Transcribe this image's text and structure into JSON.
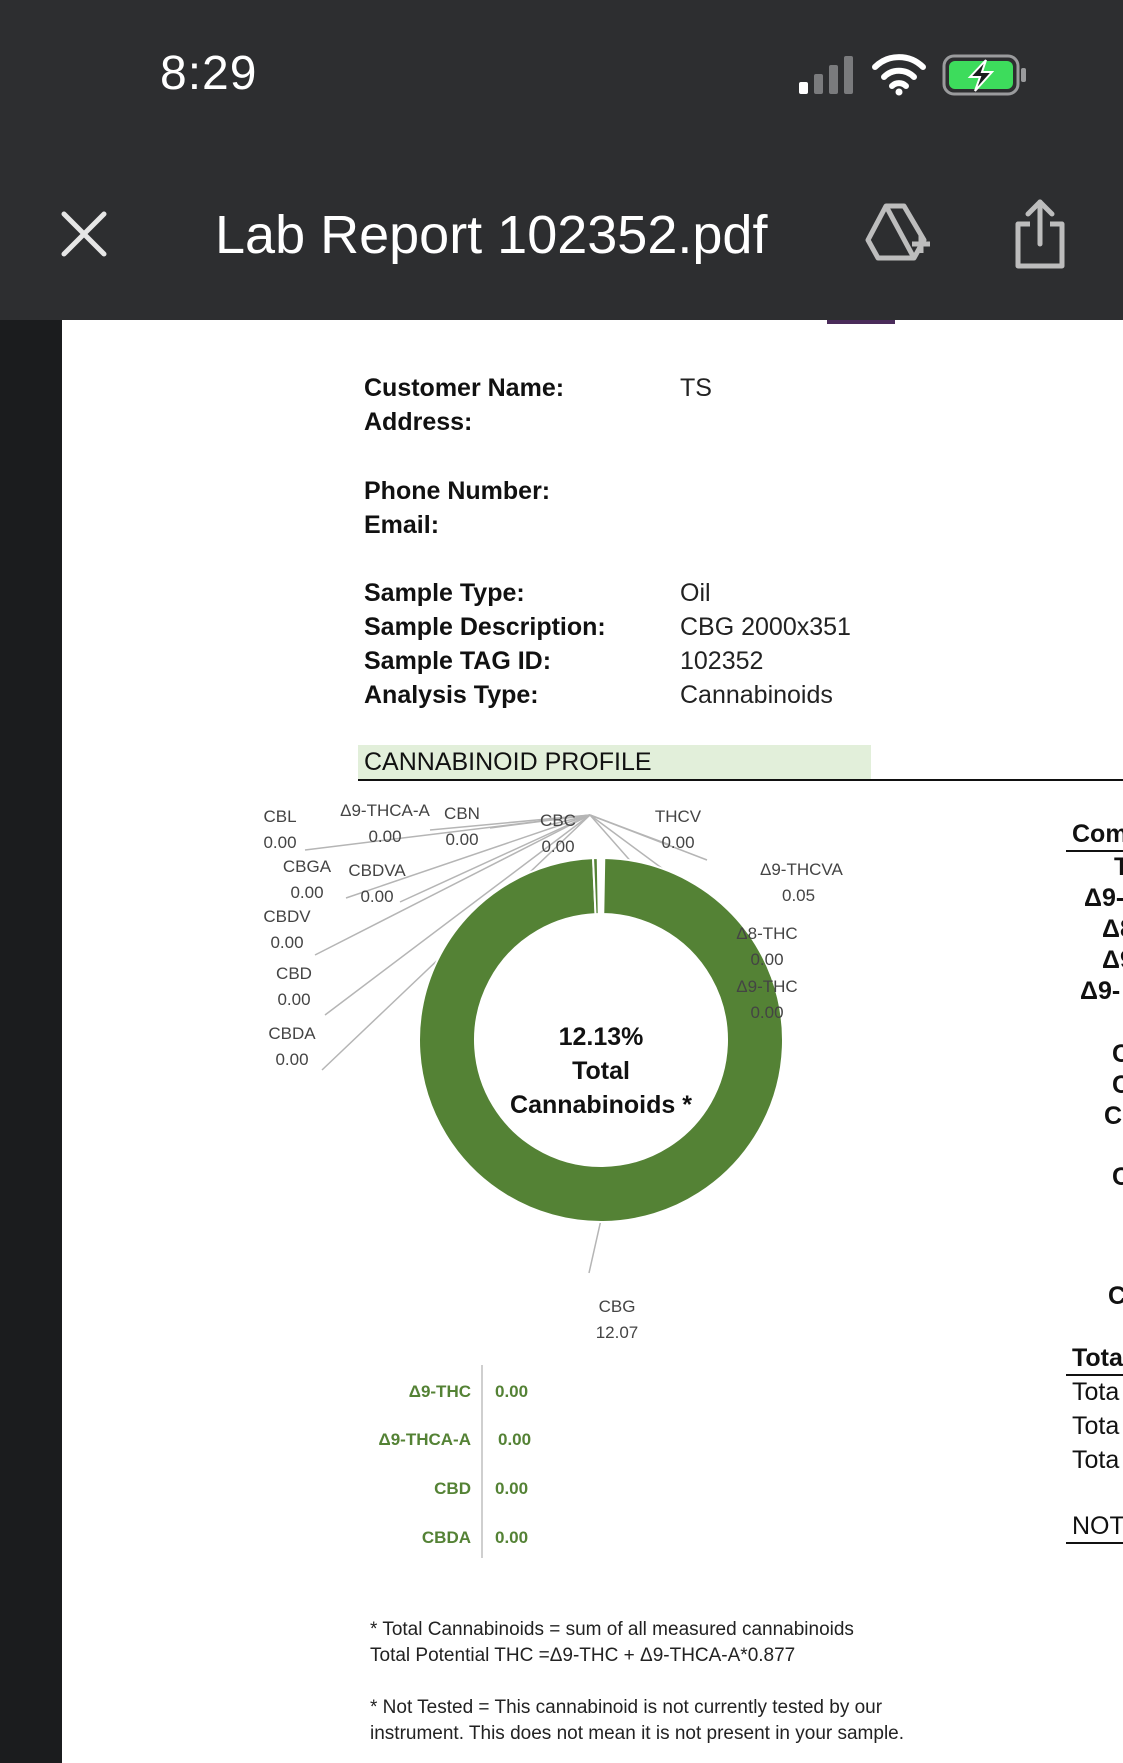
{
  "status_bar": {
    "time": "8:29"
  },
  "toolbar": {
    "title": "Lab Report 102352.pdf"
  },
  "report": {
    "customer": [
      {
        "label": "Customer Name:",
        "value": "TS"
      },
      {
        "label": "Address:",
        "value": ""
      }
    ],
    "contact": [
      {
        "label": "Phone Number:",
        "value": ""
      },
      {
        "label": "Email:",
        "value": ""
      }
    ],
    "sample": [
      {
        "label": "Sample Type:",
        "value": "Oil"
      },
      {
        "label": "Sample Description:",
        "value": "CBG 2000x351"
      },
      {
        "label": "Sample TAG ID:",
        "value": "102352"
      },
      {
        "label": "Analysis Type:",
        "value": "Cannabinoids"
      }
    ],
    "section_heading": "CANNABINOID PROFILE",
    "chart_center": {
      "line1": "12.13%",
      "line2": "Total",
      "line3": "Cannabinoids *"
    },
    "mini_table": [
      {
        "label": "Δ9-THC",
        "value": "0.00"
      },
      {
        "label": "Δ9-THCA-A",
        "value": "0.00"
      },
      {
        "label": "CBD",
        "value": "0.00"
      },
      {
        "label": "CBDA",
        "value": "0.00"
      }
    ],
    "footnotes": [
      "* Total Cannabinoids = sum of all measured cannabinoids",
      "Total Potential THC =Δ9-THC + Δ9-THCA-A*0.877",
      "* Not Tested = This cannabinoid is not currently tested by our",
      "instrument. This does not mean it is not present in your sample."
    ],
    "right_column_fragments": [
      "Com",
      "T",
      "Δ9-",
      "Δ8",
      "Δ9",
      "Δ9-",
      "C",
      "C",
      "C",
      "C",
      "C",
      "Tota",
      "Tota",
      "Tota",
      "Tota",
      "NOT"
    ]
  },
  "chart_data": {
    "type": "pie",
    "categories": [
      "CBG",
      "Δ9-THCVA",
      "CBL",
      "Δ9-THCA-A",
      "CBN",
      "CBC",
      "THCV",
      "Δ8-THC",
      "Δ9-THC",
      "CBGA",
      "CBDVA",
      "CBDV",
      "CBD",
      "CBDA"
    ],
    "values": [
      12.07,
      0.05,
      0.0,
      0.0,
      0.0,
      0.0,
      0.0,
      0.0,
      0.0,
      0.0,
      0.0,
      0.0,
      0.0,
      0.0
    ],
    "total": 12.13,
    "donut": true,
    "color": "#548235",
    "value_labels": [
      "12.07",
      "0.05",
      "0.00",
      "0.00",
      "0.00",
      "0.00",
      "0.00",
      "0.00",
      "0.00",
      "0.00",
      "0.00",
      "0.00",
      "0.00",
      "0.00"
    ]
  }
}
